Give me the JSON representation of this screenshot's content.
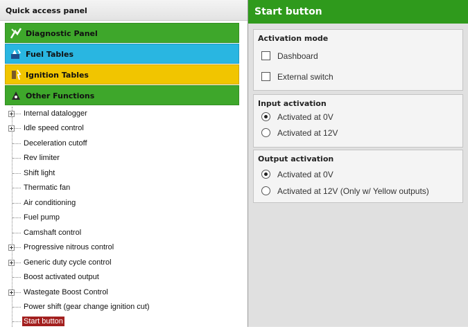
{
  "quick_access": {
    "title": "Quick access panel",
    "categories": [
      {
        "label": "Diagnostic Panel",
        "icon": "diagnostic-icon",
        "color": "#3ea72b"
      },
      {
        "label": "Fuel Tables",
        "icon": "fuel-icon",
        "color": "#29b6e1"
      },
      {
        "label": "Ignition Tables",
        "icon": "ignition-icon",
        "color": "#f1c500"
      },
      {
        "label": "Other Functions",
        "icon": "other-functions-icon",
        "color": "#3ea72b"
      }
    ],
    "tree": [
      {
        "label": "Internal datalogger",
        "expandable": true
      },
      {
        "label": "Idle speed control",
        "expandable": true
      },
      {
        "label": "Deceleration cutoff",
        "expandable": false
      },
      {
        "label": "Rev limiter",
        "expandable": false
      },
      {
        "label": "Shift light",
        "expandable": false
      },
      {
        "label": "Thermatic fan",
        "expandable": false
      },
      {
        "label": "Air conditioning",
        "expandable": false
      },
      {
        "label": "Fuel pump",
        "expandable": false
      },
      {
        "label": "Camshaft control",
        "expandable": false
      },
      {
        "label": "Progressive nitrous control",
        "expandable": true
      },
      {
        "label": "Generic duty cycle control",
        "expandable": true
      },
      {
        "label": "Boost activated output",
        "expandable": false
      },
      {
        "label": "Wastegate Boost Control",
        "expandable": true
      },
      {
        "label": "Power shift (gear change ignition cut)",
        "expandable": false
      },
      {
        "label": "Start button",
        "expandable": false,
        "selected": true
      }
    ]
  },
  "start_button": {
    "title": "Start button",
    "header_color": "#2f9a1c",
    "activation_mode": {
      "title": "Activation mode",
      "options": [
        {
          "label": "Dashboard",
          "checked": false
        },
        {
          "label": "External switch",
          "checked": false
        }
      ]
    },
    "input_activation": {
      "title": "Input activation",
      "options": [
        {
          "label": "Activated at 0V",
          "selected": true
        },
        {
          "label": "Activated at 12V",
          "selected": false
        }
      ]
    },
    "output_activation": {
      "title": "Output activation",
      "options": [
        {
          "label": "Activated at 0V",
          "selected": true
        },
        {
          "label": "Activated at 12V (Only w/ Yellow outputs)",
          "selected": false
        }
      ]
    }
  }
}
